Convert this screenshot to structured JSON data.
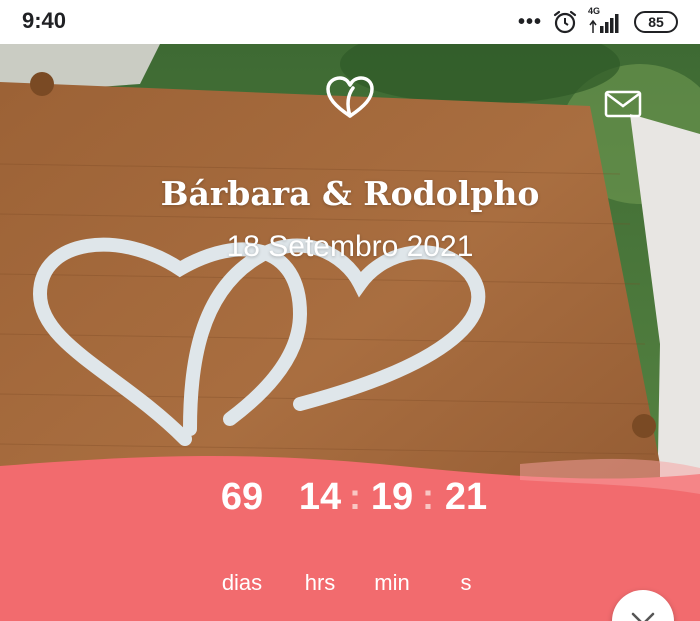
{
  "status_bar": {
    "time": "9:40",
    "dots": "•••",
    "network": "4G",
    "battery": "85"
  },
  "header": {
    "couple_names": "Bárbara & Rodolpho",
    "date": "18 Setembro 2021"
  },
  "icons": {
    "logo": "heart-icon",
    "mail": "envelope-icon",
    "scroll": "chevron-down-icon"
  },
  "countdown": {
    "days": "69",
    "days_label": "dias",
    "hours": "14",
    "hours_label": "hrs",
    "minutes": "19",
    "minutes_label": "min",
    "seconds": "21",
    "seconds_label": "s",
    "separator": ":"
  },
  "colors": {
    "band": "#f26b6e",
    "wood": "#a86a3c",
    "foliage": "#4f7a3a"
  }
}
